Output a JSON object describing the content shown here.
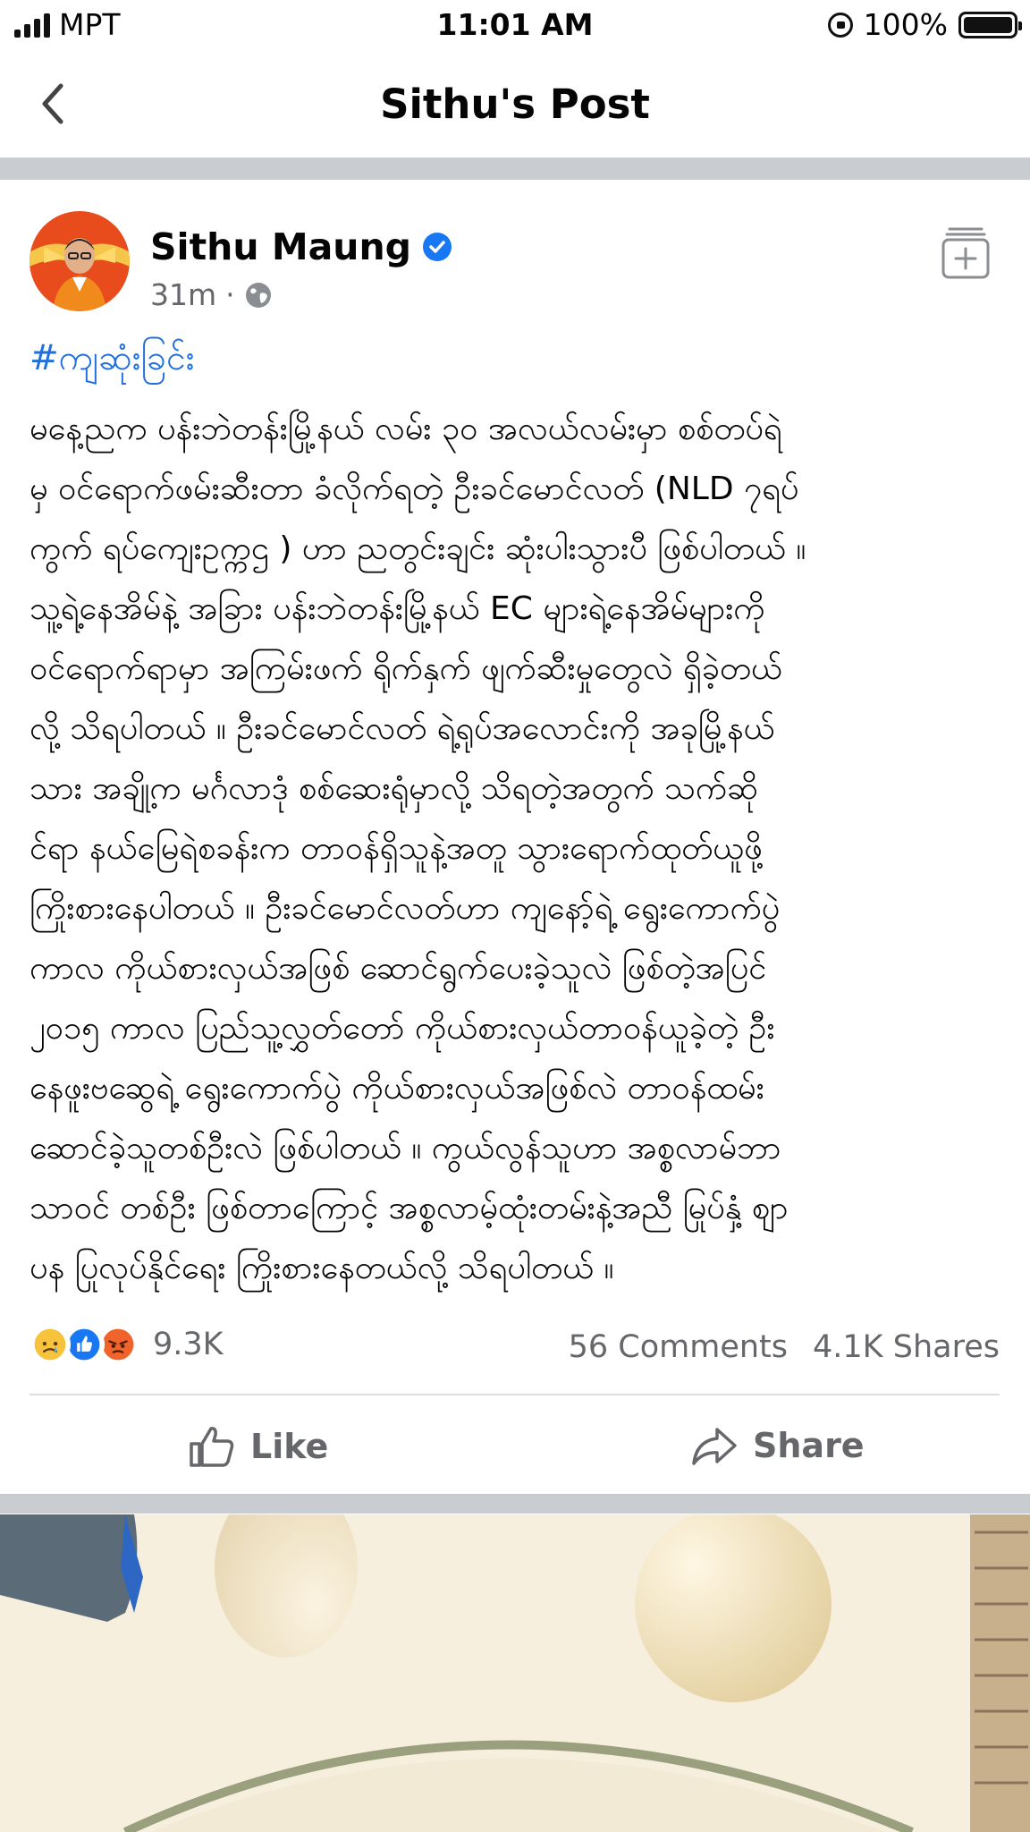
{
  "status_bar": {
    "carrier": "MPT",
    "time": "11:01 AM",
    "battery": "100%"
  },
  "nav": {
    "title": "Sithu's Post"
  },
  "post": {
    "author": "Sithu Maung",
    "time": "31m",
    "hashtag": "#ကျဆုံးခြင်း",
    "body_lines": [
      "မနေ့ညက ပန်းဘဲတန်းမြို့နယ် လမ်း ၃၀ အလယ်လမ်းမှာ စစ်တပ်ရဲ",
      "မှ ဝင်ရောက်ဖမ်းဆီးတာ ခံလိုက်ရတဲ့ ဦးခင်မောင်လတ် (NLD ၇ရပ်",
      "ကွက် ရပ်ကျေးဥက္ကဌ ) ဟာ ညတွင်းချင်း ဆုံးပါးသွားပီ ဖြစ်ပါတယ် ။",
      "သူ့ရဲ့နေအိမ်နဲ့ အခြား ပန်းဘဲတန်းမြို့နယ် EC များရဲ့နေအိမ်များကို",
      "ဝင်ရောက်ရာမှာ အကြမ်းဖက် ရိုက်နှက် ဖျက်ဆီးမှုတွေလဲ ရှိခဲ့တယ်",
      "လို့ သိရပါတယ် ။ ဦးခင်မောင်လတ် ရဲ့ရုပ်အလောင်းကို အခုမြို့နယ်",
      "သား အချို့က မင်္ဂလာဒုံ စစ်ဆေးရုံမှာလို့ သိရတဲ့အတွက် သက်ဆို",
      "င်ရာ နယ်မြေရဲစခန်းက တာဝန်ရှိသူနဲ့အတူ သွားရောက်ထုတ်ယူဖို့",
      "ကြိုးစားနေပါတယ် ။ ဦးခင်မောင်လတ်ဟာ ကျနော့်ရဲ့ ရွေးကောက်ပွဲ",
      "ကာလ ကိုယ်စားလှယ်အဖြစ် ဆောင်ရွက်ပေးခဲ့သူလဲ ဖြစ်တဲ့အပြင်",
      "၂၀၁၅ ကာလ ပြည်သူ့လွှတ်တော် ကိုယ်စားလှယ်တာဝန်ယူခဲ့တဲ့ ဦး",
      "နေဖူးဗဆွေရဲ့ ရွေးကောက်ပွဲ ကိုယ်စားလှယ်အဖြစ်လဲ တာဝန်ထမ်း",
      "ဆောင်ခဲ့သူတစ်ဦးလဲ ဖြစ်ပါတယ် ။ ကွယ်လွန်သူဟာ အစ္စလာမ်ဘာ",
      "သာဝင် တစ်ဦး ဖြစ်တာကြောင့် အစ္စလာမ့်ထုံးတမ်းနဲ့အညီ မြုပ်နှံ့ စျာ",
      "ပန ပြုလုပ်နိုင်ရေး ကြိုးစားနေတယ်လို့ သိရပါတယ် ။"
    ],
    "reaction_count": "9.3K",
    "comments": "56 Comments",
    "shares": "4.1K Shares",
    "like_label": "Like",
    "share_label": "Share"
  },
  "colors": {
    "accent": "#216fdb",
    "muted": "#65676b",
    "separator": "#c9ccd1"
  },
  "icons": [
    "back-icon",
    "verified-icon",
    "globe-icon",
    "save-icon",
    "sad-reaction-icon",
    "like-reaction-icon",
    "angry-reaction-icon",
    "like-icon",
    "share-icon"
  ]
}
